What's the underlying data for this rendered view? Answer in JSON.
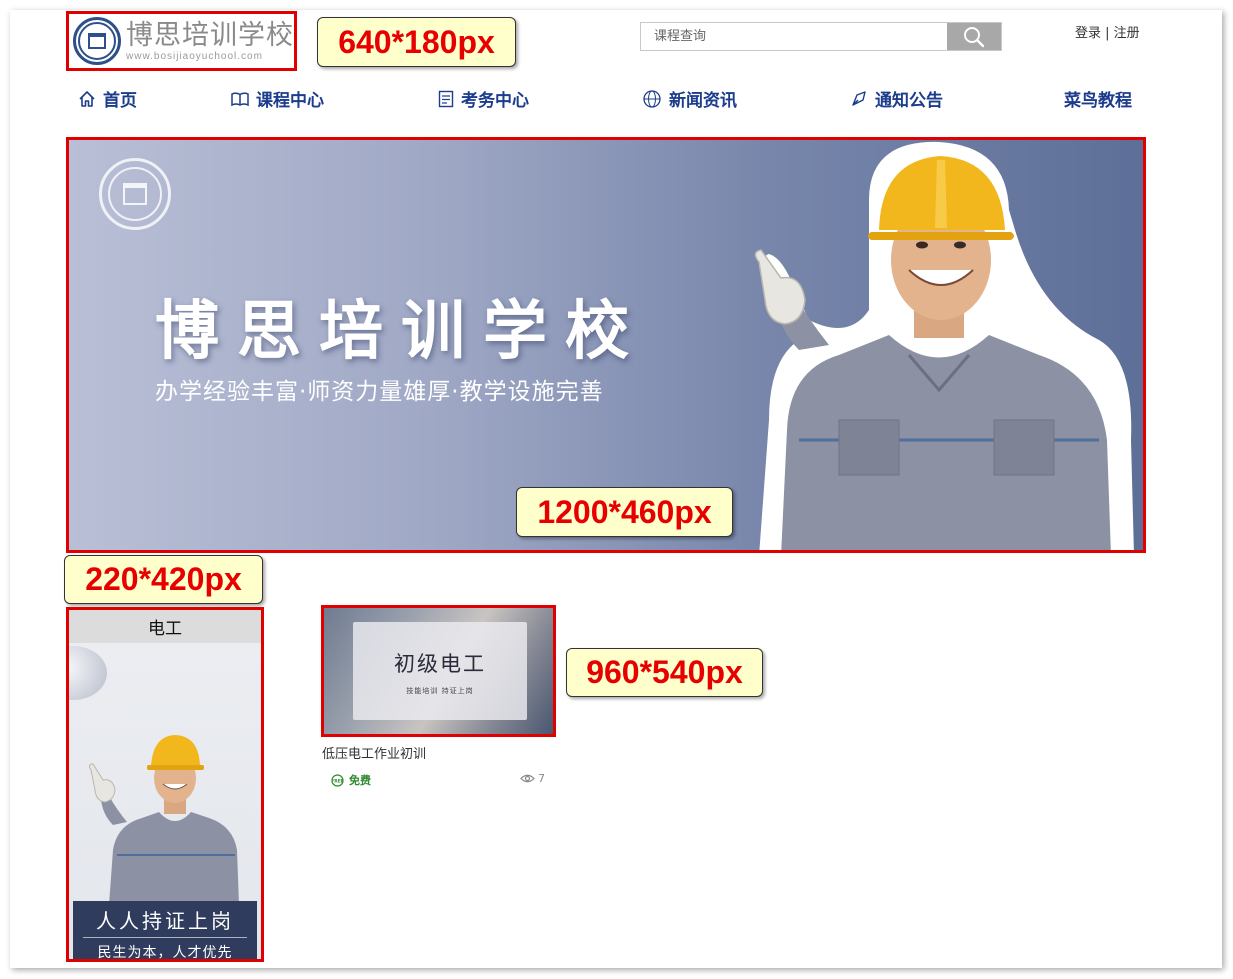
{
  "logo": {
    "name": "博思培训学校",
    "url": "www.bosijiaoyuchool.com"
  },
  "annotations": {
    "logo_size": "640*180px",
    "banner_size": "1200*460px",
    "side_size": "220*420px",
    "course_size": "960*540px"
  },
  "search": {
    "placeholder": "课程查询",
    "icon": "search-icon"
  },
  "auth": {
    "login": "登录",
    "separator": " | ",
    "register": "注册"
  },
  "nav": {
    "items": [
      {
        "label": "首页",
        "icon": "home-icon"
      },
      {
        "label": "课程中心",
        "icon": "book-icon"
      },
      {
        "label": "考务中心",
        "icon": "exam-icon"
      },
      {
        "label": "新闻资讯",
        "icon": "news-icon"
      },
      {
        "label": "通知公告",
        "icon": "notice-icon"
      },
      {
        "label": "菜鸟教程",
        "icon": ""
      }
    ]
  },
  "banner": {
    "title": "博思培训学校",
    "subtitle": "办学经验丰富·师资力量雄厚·教学设施完善"
  },
  "side": {
    "title": "电工",
    "caption_line1": "人人持证上岗",
    "caption_line2": "民生为本，人才优先"
  },
  "course": {
    "thumb_title": "初级电工",
    "thumb_sub": "技能培训 持证上岗",
    "name": "低压电工作业初训",
    "price": "免费",
    "views": "7"
  },
  "colors": {
    "nav": "#1c3c8c",
    "annotation_border": "#e10000",
    "tag_bg": "#ffffcc",
    "free": "#2e8b2e"
  }
}
